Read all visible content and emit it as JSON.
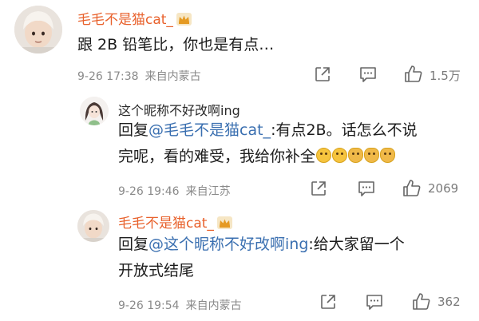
{
  "comments": [
    {
      "username": "毛毛不是猫cat_",
      "text_line1": "跟 2B 铅笔比，你也是有点…",
      "time": "9-26 17:38",
      "location": "来自内蒙古",
      "likes": "1.5万"
    },
    {
      "username": "这个昵称不好改啊ing",
      "reply_prefix": "回复",
      "mention": "@毛毛不是猫cat_",
      "text_line1_rest": ":有点2B。话怎么不说",
      "text_line2": "完呢，看的难受，我给你补全",
      "time": "9-26 19:46",
      "location": "来自江苏",
      "likes": "2069"
    },
    {
      "username": "毛毛不是猫cat_",
      "reply_prefix": "回复",
      "mention": "@这个昵称不好改啊ing",
      "text_line1_rest": ":给大家留一个",
      "text_line2": "开放式结尾",
      "time": "9-26 19:54",
      "location": "来自内蒙古",
      "likes": "362"
    }
  ],
  "colors": {
    "username": "#e8612c",
    "mention": "#3a6fb0",
    "meta": "#8a8a8a"
  },
  "icons": [
    "crown-badge-icon",
    "share-icon",
    "comment-icon",
    "like-icon",
    "emoji-icon"
  ]
}
